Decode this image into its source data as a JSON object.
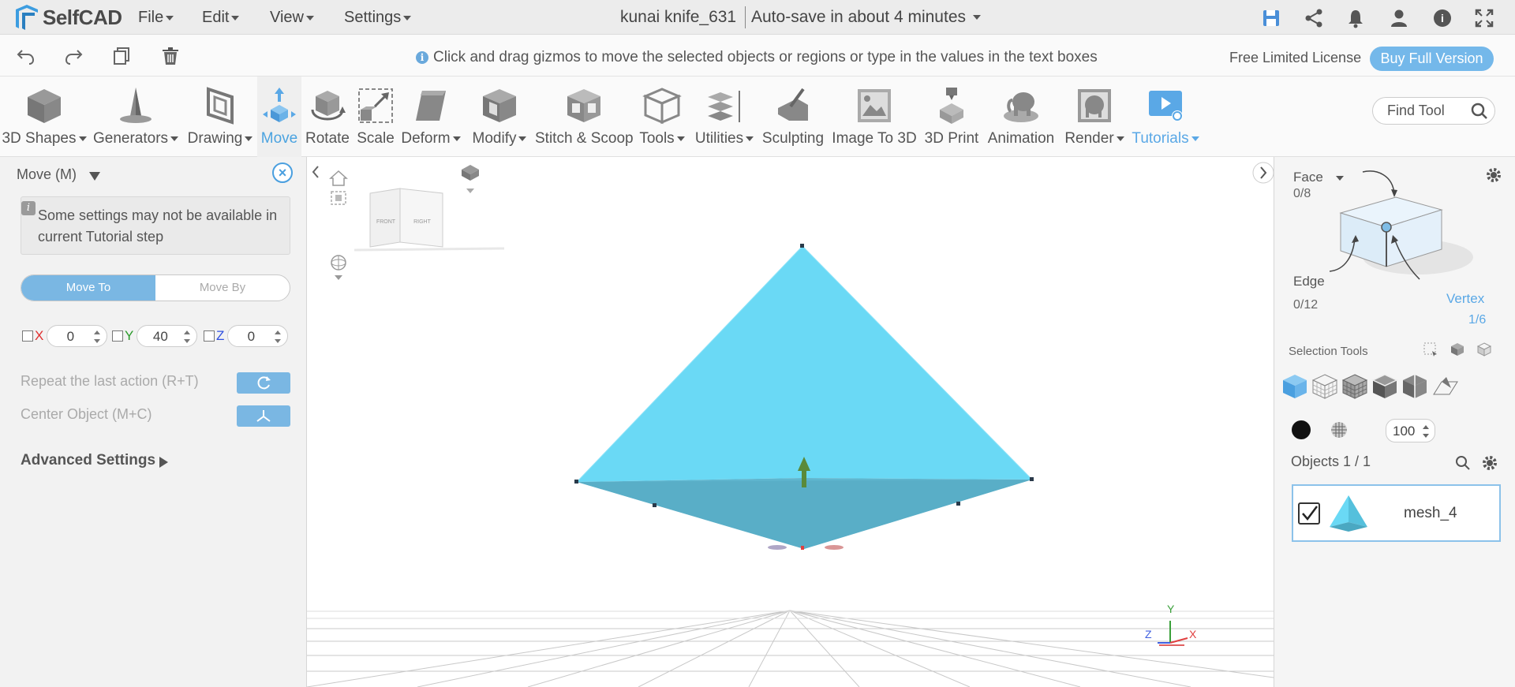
{
  "app": {
    "name": "SelfCAD",
    "menus": [
      "File",
      "Edit",
      "View",
      "Settings"
    ],
    "doc_title": "kunai knife_631",
    "autosave": "Auto-save in about 4 minutes",
    "top_icons": [
      "save-icon",
      "share-icon",
      "bell-icon",
      "user-icon",
      "help-icon",
      "fullscreen-icon"
    ]
  },
  "bar2": {
    "hint": "Click and drag gizmos to move the selected objects or regions or type in the values in the text boxes",
    "license": "Free Limited License",
    "buy_label": "Buy Full Version"
  },
  "toolbar": {
    "tools": [
      {
        "label": "3D Shapes",
        "dropdown": true
      },
      {
        "label": "Generators",
        "dropdown": true
      },
      {
        "label": "Drawing",
        "dropdown": true
      },
      {
        "label": "Move",
        "dropdown": false,
        "active": true
      },
      {
        "label": "Rotate",
        "dropdown": false
      },
      {
        "label": "Scale",
        "dropdown": false
      },
      {
        "label": "Deform",
        "dropdown": true
      },
      {
        "label": "Modify",
        "dropdown": true
      },
      {
        "label": "Stitch & Scoop",
        "dropdown": false
      },
      {
        "label": "Tools",
        "dropdown": true
      },
      {
        "label": "Utilities",
        "dropdown": true
      },
      {
        "label": "Sculpting",
        "dropdown": false
      },
      {
        "label": "Image To 3D",
        "dropdown": false
      },
      {
        "label": "3D Print",
        "dropdown": false
      },
      {
        "label": "Animation",
        "dropdown": false
      },
      {
        "label": "Render",
        "dropdown": true
      },
      {
        "label": "Tutorials",
        "dropdown": true
      }
    ],
    "find_placeholder": "Find Tool"
  },
  "left_panel": {
    "title": "Move (M)",
    "note": "Some settings may not be available in current Tutorial step",
    "seg_move_to": "Move To",
    "seg_move_by": "Move By",
    "axes": [
      {
        "label": "X",
        "value": "0",
        "color": "#e03030"
      },
      {
        "label": "Y",
        "value": "40",
        "color": "#2a9a2a"
      },
      {
        "label": "Z",
        "value": "0",
        "color": "#3050e0"
      }
    ],
    "repeat_label": "Repeat the last action (R+T)",
    "center_label": "Center Object (M+C)",
    "advanced_label": "Advanced Settings"
  },
  "viewport": {
    "viewcube": {
      "front": "FRONT",
      "right": "RIGHT"
    },
    "gizmo": {
      "x": "X",
      "y": "Y",
      "z": "Z"
    },
    "mesh_color": "#6ad9f5"
  },
  "right_panel": {
    "face_label": "Face",
    "face_count": "0/8",
    "edge_label": "Edge",
    "edge_count": "0/12",
    "vertex_label": "Vertex",
    "vertex_count": "1/6",
    "selection_tools": "Selection Tools",
    "opacity": "100",
    "objects_label": "Objects 1 / 1",
    "object_name": "mesh_4"
  }
}
